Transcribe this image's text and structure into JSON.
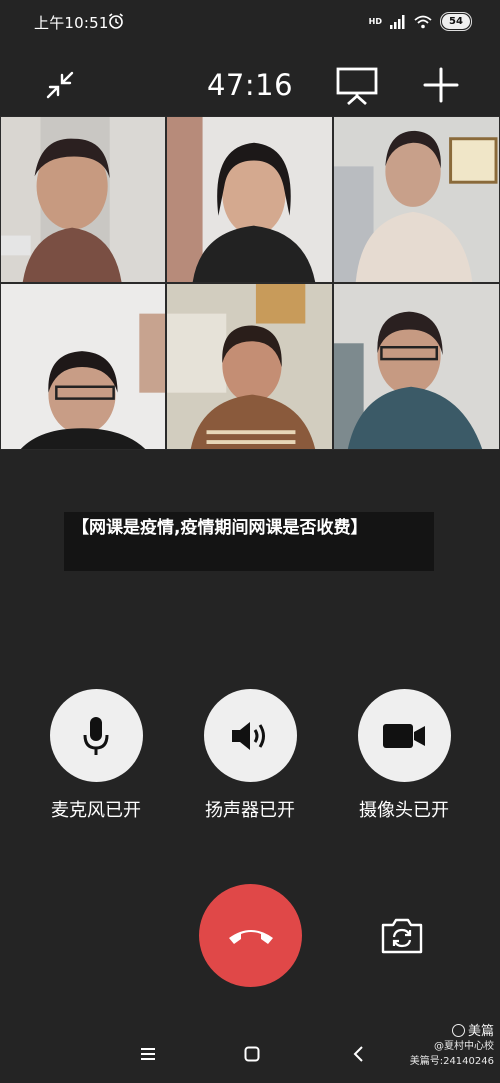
{
  "status_bar": {
    "time": "上午10:51",
    "network": "HD",
    "battery": "54",
    "icons": [
      "alarm-icon",
      "signal-icon",
      "wifi-icon",
      "battery-icon"
    ]
  },
  "call": {
    "timer": "47:16",
    "icons": [
      "minimize-icon",
      "screen-share-icon",
      "add-member-icon"
    ]
  },
  "video_tiles": [
    {
      "name": "participant-1"
    },
    {
      "name": "participant-2"
    },
    {
      "name": "participant-3"
    },
    {
      "name": "participant-4"
    },
    {
      "name": "participant-5"
    },
    {
      "name": "participant-6"
    }
  ],
  "banner": {
    "title": "【网课是疫情,疫情期间网课是否收费】"
  },
  "controls": {
    "mic_label": "麦克风已开",
    "speaker_label": "扬声器已开",
    "camera_label": "摄像头已开",
    "mic_icon": "microphone-icon",
    "speaker_icon": "speaker-icon",
    "camera_icon": "video-camera-icon",
    "hangup_icon": "phone-hangup-icon",
    "switch_camera_icon": "switch-camera-icon",
    "hangup_color": "#e04848"
  },
  "nav": {
    "icons": [
      "menu-icon",
      "home-icon",
      "back-icon"
    ]
  },
  "watermark": {
    "brand": "美篇",
    "author": "@夏村中心校",
    "id": "美篇号:24140246"
  }
}
